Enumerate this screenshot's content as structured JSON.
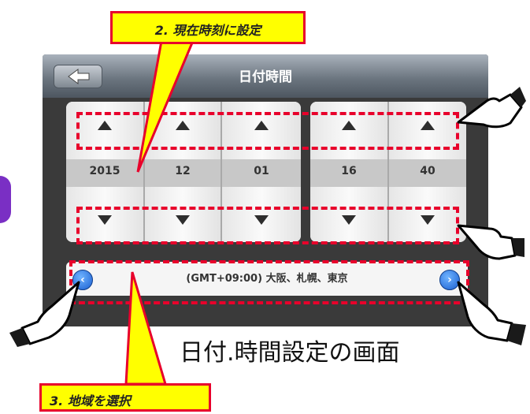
{
  "screen": {
    "title": "日付時間",
    "back_arrow": "←",
    "date_time": {
      "year": "2015",
      "month": "12",
      "day": "01",
      "hour": "16",
      "minute": "40"
    },
    "timezone": "(GMT+09:00) 大阪、札幌、東京",
    "prev_arrow": "‹",
    "next_arrow": "›"
  },
  "annotations": {
    "callout_top": "2. 現在時刻に設定",
    "callout_bottom": "3. 地域を選択",
    "caption": "日付.時間設定の画面"
  },
  "icons": [
    "back-arrow-icon",
    "up-arrow-icon",
    "down-arrow-icon",
    "chevron-left-icon",
    "chevron-right-icon",
    "pointing-hand-icon"
  ],
  "colors": {
    "annotation_red": "#e8002b",
    "callout_yellow": "#ffff00",
    "nav_blue": "#1a5fd1"
  }
}
